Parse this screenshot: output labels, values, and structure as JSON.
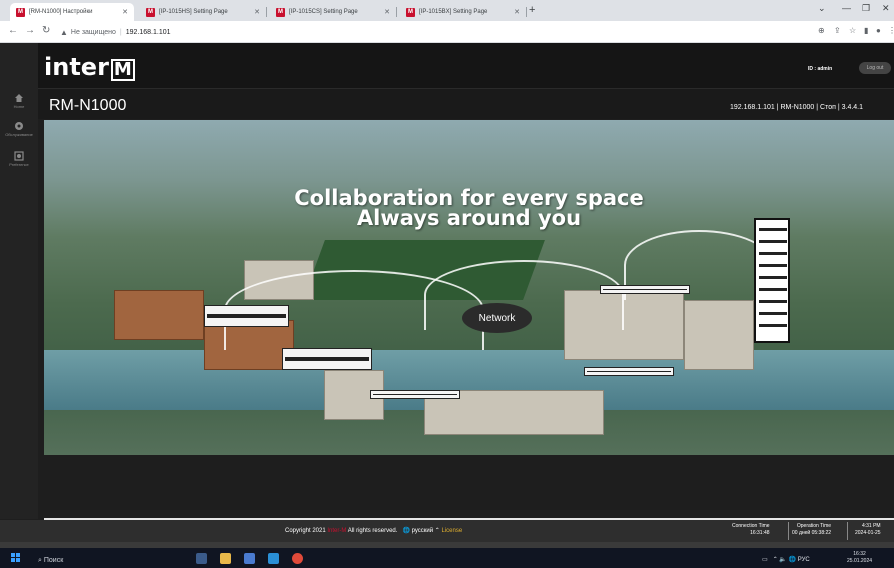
{
  "browser": {
    "tabs": [
      {
        "label": "[RM-N1000] Настройки",
        "favicon": "M"
      },
      {
        "label": "[IP-1015HS] Setting Page",
        "favicon": "M"
      },
      {
        "label": "[IP-1015CS] Setting Page",
        "favicon": "M"
      },
      {
        "label": "[IP-1015BX] Setting Page",
        "favicon": "M"
      }
    ],
    "new_tab": "+",
    "insecure_label": "Не защищено",
    "url": "192.168.1.101"
  },
  "nav": {
    "items": [
      {
        "label": "Home",
        "icon": "home-icon"
      },
      {
        "label": "Обслуживание",
        "icon": "maintenance-icon"
      },
      {
        "label": "Preference",
        "icon": "preference-icon"
      }
    ]
  },
  "header": {
    "logo_text": "inter",
    "logo_mark": "M",
    "user_id": "ID : admin",
    "logout": "Log out"
  },
  "title": {
    "device_name": "RM-N1000",
    "device_info": "192.168.1.101 | RM-N1000 | Стоп | 3.4.4.1"
  },
  "hero": {
    "headline_1": "Collaboration for every space",
    "headline_2": "Always around you",
    "network_label": "Network"
  },
  "footer": {
    "copyright_prefix": "Copyright 2021",
    "brand": "Inter-M",
    "rights": "All rights reserved.",
    "language": "русский",
    "license": "License",
    "connection_time_label": "Connection Time",
    "connection_time": "16:31:48",
    "operation_time_label": "Operation Time",
    "operation_time": "00 дней 05:38:22",
    "current_time": "4:31 PM",
    "current_date": "2024-01-25"
  },
  "taskbar": {
    "search": "Поиск",
    "lang": "РУС",
    "time": "16:32",
    "date": "25.01.2024"
  },
  "colors": {
    "brand_red": "#c8102e",
    "page_bg": "#1e1e1e",
    "license_gold": "#e0b030"
  }
}
